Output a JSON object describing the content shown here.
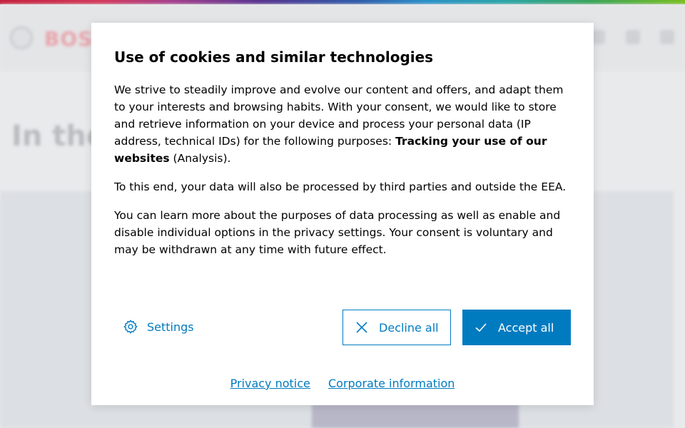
{
  "background": {
    "logo_text": "BOSCH",
    "page_heading": "In the"
  },
  "dialog": {
    "title": "Use of cookies and similar technologies",
    "para1_text": "We strive to steadily improve and evolve our content and offers, and adapt them to your interests and browsing habits. With your consent, we would like to store and retrieve information on your device and process your personal data (IP address, technical IDs) for the following purposes: ",
    "para1_bold": "Tracking your use of our websites",
    "para1_tail": " (Analysis).",
    "para2": "To this end, your data will also be processed by third parties and outside the EEA.",
    "para3": "You can learn more about the purposes of data processing as well as enable and disable individual options in the privacy settings. Your consent is voluntary and may be withdrawn at any time with future effect.",
    "settings_label": "Settings",
    "decline_label": "Decline all",
    "accept_label": "Accept all",
    "privacy_link": "Privacy notice",
    "corporate_link": "Corporate information"
  },
  "colors": {
    "accent": "#007bc0",
    "text": "#000000",
    "overlay_bg": "#e9eaec"
  },
  "icons": {
    "settings": "gear-icon",
    "decline": "close-icon",
    "accept": "checkmark-icon"
  }
}
